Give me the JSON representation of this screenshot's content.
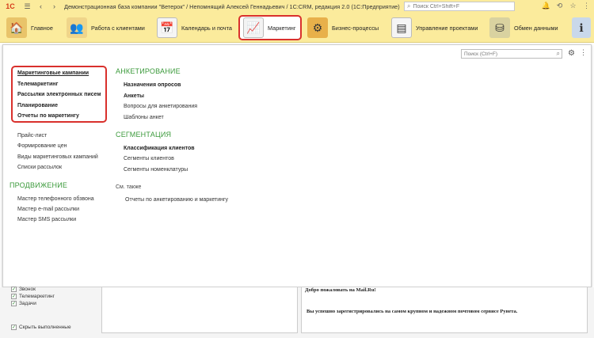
{
  "titlebar": {
    "logo": "1С",
    "title": "Демонстрационная база компании \"Ветерок\" / Непомнящий Алексей Геннадьевич / 1С:CRM, редакция 2.0  (1С:Предприятие)",
    "search_placeholder": "Поиск Ctrl+Shift+F"
  },
  "sections": [
    {
      "label": "Главное",
      "icon": "home-icon"
    },
    {
      "label": "Работа с клиентами",
      "icon": "clients-icon"
    },
    {
      "label": "Календарь и почта",
      "icon": "calendar-icon"
    },
    {
      "label": "Маркетинг",
      "icon": "marketing-icon",
      "active": true
    },
    {
      "label": "Бизнес-процессы",
      "icon": "business-process-icon"
    },
    {
      "label": "Управление проектами",
      "icon": "projects-icon"
    },
    {
      "label": "Обмен данными",
      "icon": "data-exchange-icon"
    }
  ],
  "panel": {
    "search_placeholder": "Поиск (Ctrl+F)",
    "highlighted_links": [
      "Маркетинговые кампании",
      "Телемаркетинг",
      "Рассылки электронных писем",
      "Планирование",
      "Отчеты по маркетингу"
    ],
    "left_links": [
      "Прайс-лист",
      "Формирование цен",
      "Виды маркетинговых кампаний",
      "Списки рассылок"
    ],
    "promo_heading": "ПРОДВИЖЕНИЕ",
    "promo_links": [
      "Мастер телефонного обзвона",
      "Мастер e-mail рассылки",
      "Мастер SMS рассылки"
    ],
    "survey_heading": "АНКЕТИРОВАНИЕ",
    "survey_bold": [
      "Назначения опросов",
      "Анкеты"
    ],
    "survey_links": [
      "Вопросы для анкетирования",
      "Шаблоны анкет"
    ],
    "segment_heading": "СЕГМЕНТАЦИЯ",
    "segment_bold": [
      "Классификация клиентов"
    ],
    "segment_links": [
      "Сегменты клиентов",
      "Сегменты номенклатуры"
    ],
    "see_also": "См. также",
    "see_also_links": [
      "Отчеты по анкетированию и маркетингу"
    ]
  },
  "bottom": {
    "checks": [
      "Звонок",
      "Телемаркетинг",
      "Задачи"
    ],
    "hide_done": "Скрыть выполненные",
    "mail_line1": "Добро пожаловать на Mail.Ru!",
    "mail_line2": "Вы успешно зарегистрировались на самом крупном и надежном почтовом сервисе Рунета."
  },
  "colors": {
    "topbar": "#fbeb9c",
    "highlight": "#d9302c",
    "heading_green": "#3b9a3b"
  }
}
